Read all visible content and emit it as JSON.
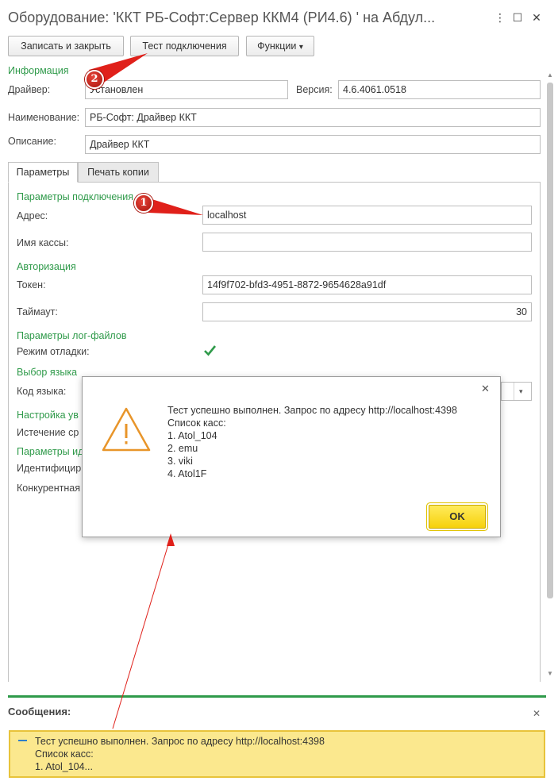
{
  "window": {
    "title": "Оборудование: 'ККТ РБ-Софт:Сервер ККМ4 (РИ4.6) ' на Абдул...",
    "more_icon": "kebab-icon",
    "maximize_icon": "maximize-icon",
    "close_icon": "close-icon"
  },
  "toolbar": {
    "save_close_label": "Записать и закрыть",
    "test_connection_label": "Тест подключения",
    "functions_label": "Функции",
    "functions_arrow": "▾"
  },
  "info": {
    "section_label": "Информация",
    "driver_label": "Драйвер:",
    "driver_value": "Установлен",
    "version_label": "Версия:",
    "version_value": "4.6.4061.0518",
    "name_label": "Наименование:",
    "name_value": "РБ-Софт: Драйвер ККТ",
    "description_label": "Описание:",
    "description_value": "Драйвер ККТ"
  },
  "tabs": [
    {
      "label": "Параметры"
    },
    {
      "label": "Печать копии"
    }
  ],
  "params": {
    "connection_section": "Параметры подключения",
    "address_label": "Адрес:",
    "address_value": "localhost",
    "cashbox_name_label": "Имя кассы:",
    "cashbox_name_value": "",
    "auth_section": "Авторизация",
    "token_label": "Токен:",
    "token_value": "14f9f702-bfd3-4951-8872-9654628a91df",
    "timeout_label": "Таймаут:",
    "timeout_value": "30",
    "log_section": "Параметры лог-файлов",
    "debug_label": "Режим отладки:",
    "language_section": "Выбор языка",
    "language_code_label": "Код языка:",
    "notify_section": "Настройка ув",
    "expiry_label": "Истечение ср",
    "ident_section": "Параметры ид",
    "ident_label": "Идентифицир",
    "concurrent_label": "Конкурентная"
  },
  "modal": {
    "line1": "Тест успешно выполнен. Запрос по адресу http://localhost:4398",
    "line2": "Список касс:",
    "line3": "1. Atol_104",
    "line4": "2. emu",
    "line5": "3. viki",
    "line6": "4. Atol1F",
    "ok_label": "OK",
    "close_symbol": "✕"
  },
  "messages": {
    "title": "Сообщения:",
    "close_symbol": "✕",
    "line1": "Тест успешно выполнен. Запрос по адресу http://localhost:4398",
    "line2": "Список касс:",
    "line3": "1. Atol_104..."
  },
  "annotations": {
    "badge1": "1",
    "badge2": "2"
  },
  "colors": {
    "accent_green": "#2f9a4a",
    "ok_yellow": "#f6d10b",
    "warning_orange": "#e8952a",
    "annotation_red": "#e0201a"
  }
}
